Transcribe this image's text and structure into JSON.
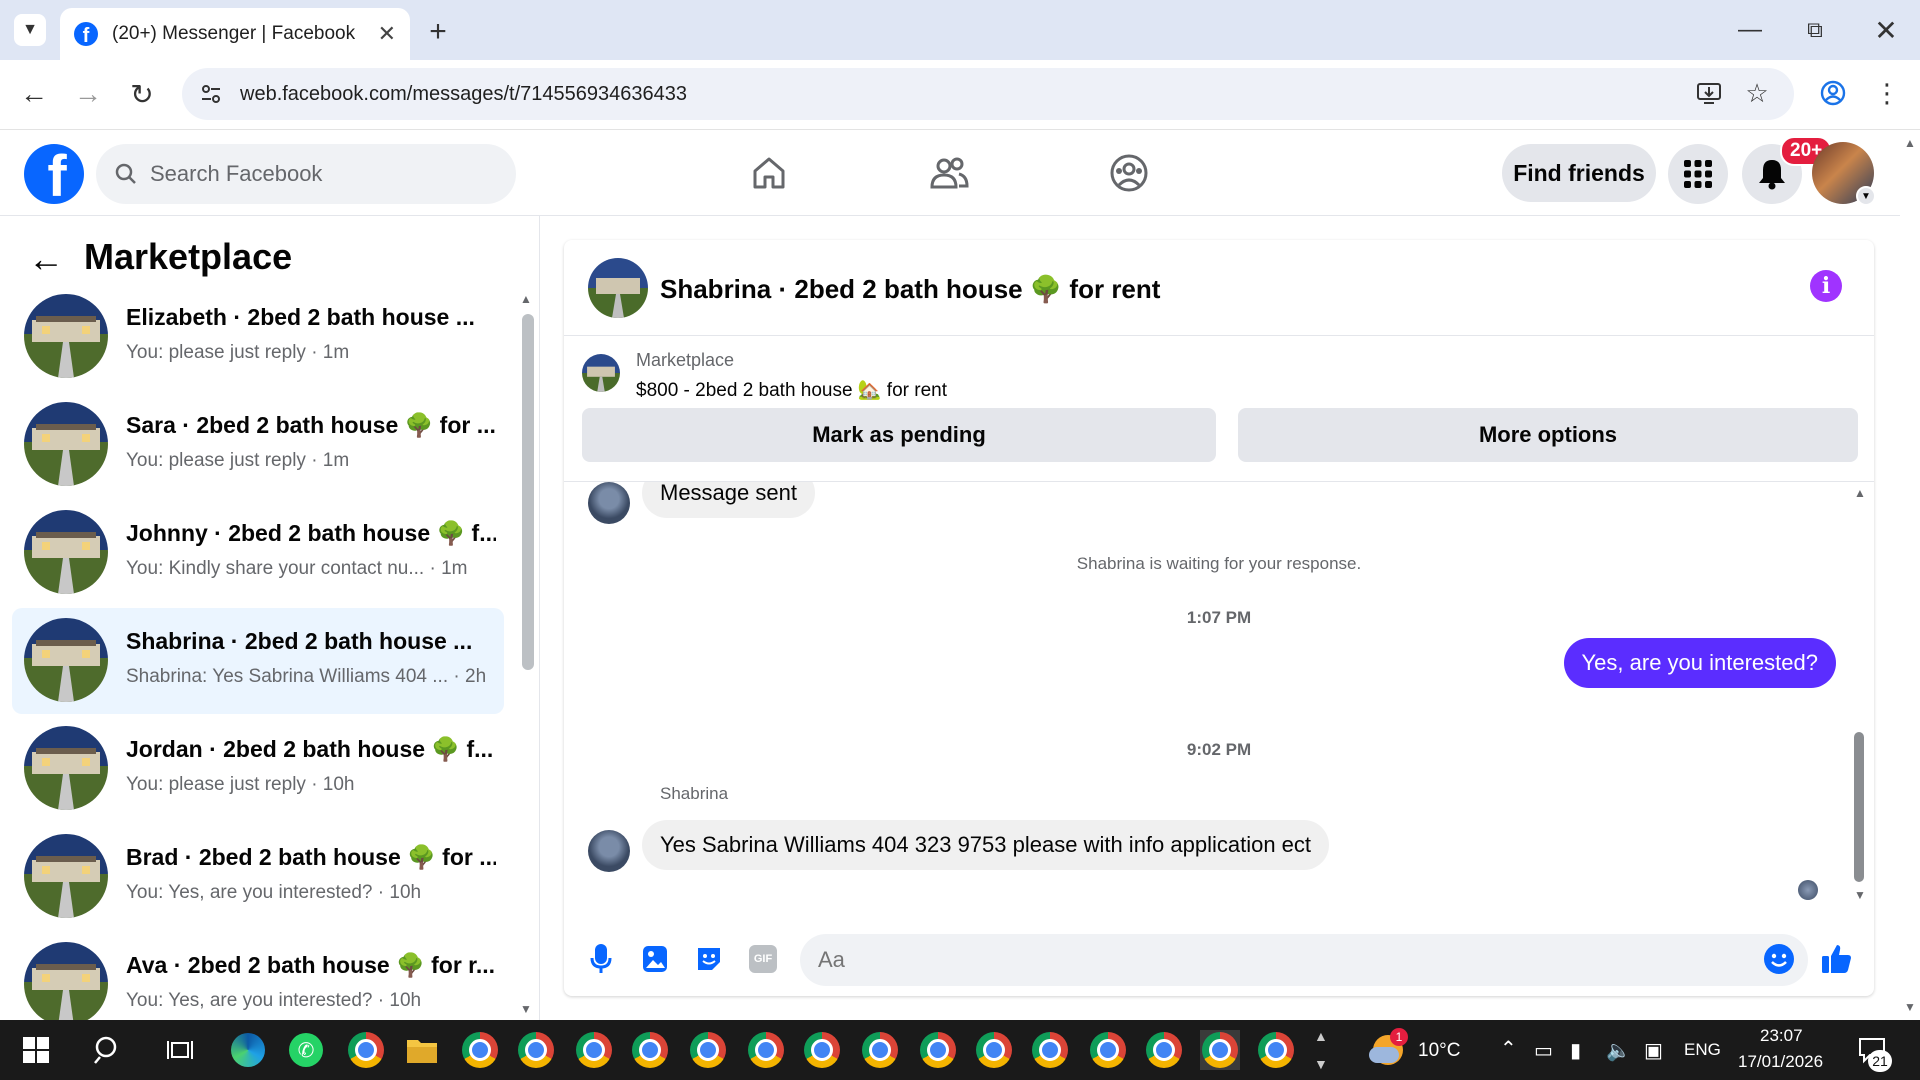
{
  "browser": {
    "tab_title": "(20+) Messenger | Facebook",
    "url": "web.facebook.com/messages/t/714556934636433"
  },
  "fb": {
    "search_placeholder": "Search Facebook",
    "find_friends": "Find friends",
    "notification_badge": "20+"
  },
  "sidebar": {
    "title": "Marketplace",
    "conversations": [
      {
        "name": "Elizabeth · 2bed 2 bath house ...",
        "preview": "You: please just reply · 1m",
        "active": false
      },
      {
        "name": "Sara · 2bed 2 bath house 🌳 for ...",
        "preview": "You: please just reply · 1m",
        "active": false
      },
      {
        "name": "Johnny · 2bed 2 bath house 🌳 f...",
        "preview": "You: Kindly share your contact nu...   · 1m",
        "active": false
      },
      {
        "name": "Shabrina · 2bed 2 bath house ...",
        "preview": "Shabrina: Yes Sabrina Williams 404 ...  · 2h",
        "active": true
      },
      {
        "name": "Jordan · 2bed 2 bath house 🌳 f...",
        "preview": "You: please just reply · 10h",
        "active": false
      },
      {
        "name": "Brad · 2bed 2 bath house 🌳 for ...",
        "preview": "You: Yes, are you interested? · 10h",
        "active": false
      },
      {
        "name": "Ava · 2bed 2 bath house 🌳 for r...",
        "preview": "You: Yes, are you interested? · 10h",
        "active": false
      }
    ]
  },
  "chat": {
    "title": "Shabrina · 2bed 2 bath house 🌳 for rent",
    "listing_source": "Marketplace",
    "listing_title": "$800 - 2bed 2 bath house 🏡 for rent",
    "mark_pending": "Mark as pending",
    "more_options": "More options",
    "msg_sent": "Message sent",
    "waiting": "Shabrina is waiting for your response.",
    "ts1": "1:07 PM",
    "out_msg": "Yes, are you interested?",
    "ts2": "9:02 PM",
    "sender": "Shabrina",
    "in_msg": "Yes Sabrina Williams 404 323 9753 please with info application ect",
    "input_placeholder": "Aa"
  },
  "taskbar": {
    "temp": "10°C",
    "weather_badge": "1",
    "lang": "ENG",
    "time": "23:07",
    "date": "17/01/2026",
    "notif_count": "21"
  },
  "colors": {
    "fb_blue": "#0866ff",
    "messenger_purple": "#5b2dff",
    "info_purple": "#a033ff",
    "badge_red": "#e41e3f"
  }
}
